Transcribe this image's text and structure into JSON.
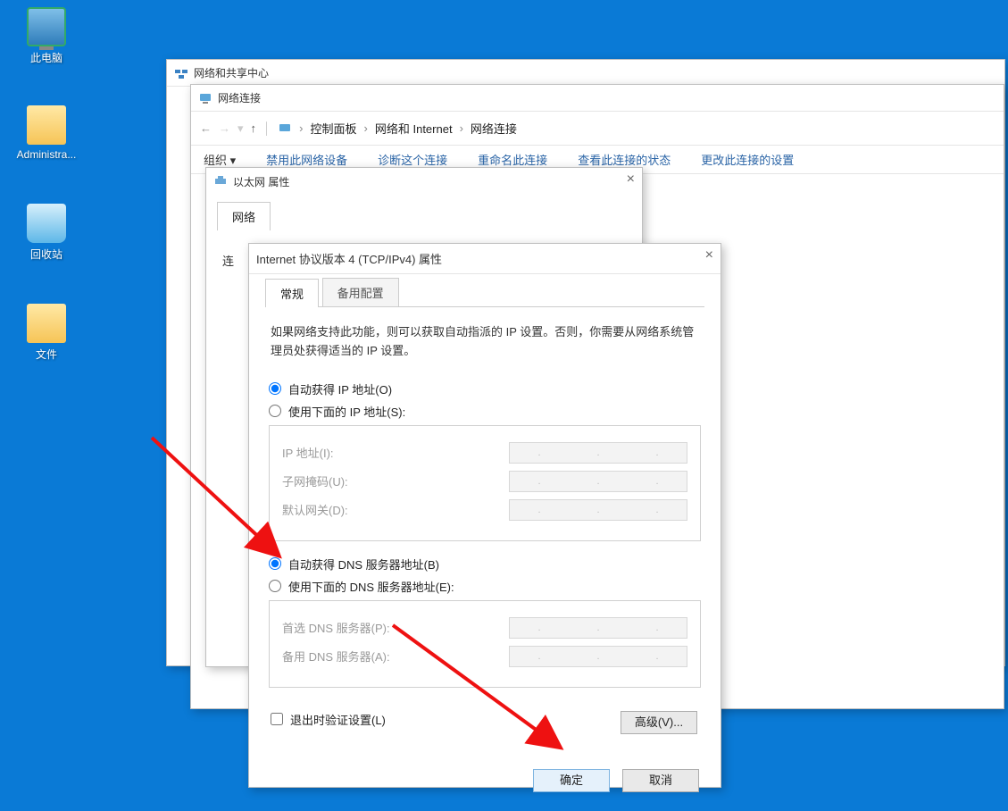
{
  "desktop": {
    "this_pc": "此电脑",
    "admin": "Administra...",
    "recycle": "回收站",
    "files": "文件"
  },
  "win_sharing": {
    "title": "网络和共享中心"
  },
  "win_netconn": {
    "title": "网络连接",
    "breadcrumb": {
      "a": "控制面板",
      "b": "网络和 Internet",
      "c": "网络连接"
    },
    "toolbar": {
      "org": "组织 ▾",
      "disable": "禁用此网络设备",
      "diagnose": "诊断这个连接",
      "rename": "重命名此连接",
      "status": "查看此连接的状态",
      "change": "更改此连接的设置"
    }
  },
  "win_eth": {
    "title": "以太网 属性",
    "tab_network": "网络",
    "connect_label_prefix": "连"
  },
  "ipv4": {
    "title": "Internet 协议版本 4 (TCP/IPv4) 属性",
    "tab_general": "常规",
    "tab_alt": "备用配置",
    "desc": "如果网络支持此功能，则可以获取自动指派的 IP 设置。否则，你需要从网络系统管理员处获得适当的 IP 设置。",
    "ip_auto": "自动获得 IP 地址(O)",
    "ip_manual": "使用下面的 IP 地址(S):",
    "ip_addr": "IP 地址(I):",
    "subnet": "子网掩码(U):",
    "gateway": "默认网关(D):",
    "dns_auto": "自动获得 DNS 服务器地址(B)",
    "dns_manual": "使用下面的 DNS 服务器地址(E):",
    "dns_pref": "首选 DNS 服务器(P):",
    "dns_alt": "备用 DNS 服务器(A):",
    "validate": "退出时验证设置(L)",
    "advanced": "高级(V)...",
    "ok": "确定",
    "cancel": "取消"
  }
}
